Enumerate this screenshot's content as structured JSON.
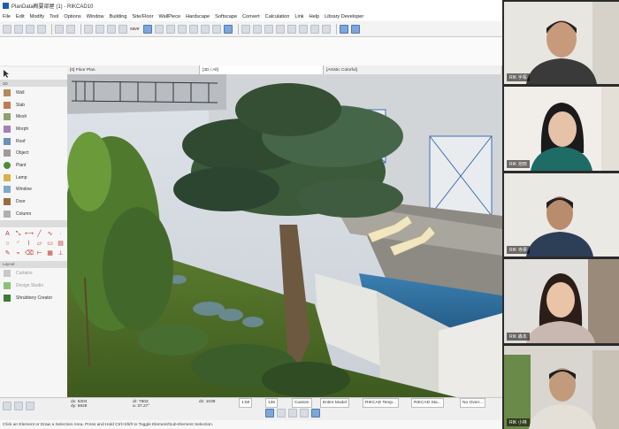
{
  "window": {
    "title": "PlanData概要部屋 (1) - RIKCAD10"
  },
  "menu": [
    "File",
    "Edit",
    "Modify",
    "Tool",
    "Options",
    "Window",
    "Building",
    "Site/Floor",
    "WallPiece",
    "Hardscape",
    "Softscape",
    "Convert",
    "Calculation",
    "Link",
    "Help",
    "Library Developer"
  ],
  "toolbar": {
    "save_label": "save"
  },
  "tabs": [
    "[0] Floor Plan",
    "[3D / All]",
    "[Artistic Colorful]"
  ],
  "toolbox": {
    "tools": [
      "Wall",
      "Slab",
      "Mesh",
      "Morph",
      "Roof",
      "Object",
      "Plant",
      "Lamp",
      "Window",
      "Door",
      "Column"
    ],
    "layout_section": "Layout",
    "layout_items": [
      "Curtains",
      "Design Studio",
      "Shrubbery Creator"
    ]
  },
  "status": {
    "coords": [
      "dx: 5304",
      "dy: 6828",
      "dr: 7503",
      "a: 37.27°",
      "dz: 1039"
    ],
    "scale": "1:50",
    "zoom": "136",
    "view": "Custom",
    "pen": "Entire Model",
    "layer1": "RIKCAD Temp...",
    "layer2": "RIKCAD Sta...",
    "no_overr": "No Overr...",
    "hint": "Click an Element or Draw a Selection Area. Press and Hold Ctrl+Shift to Toggle Element/Sub-Element Selection."
  },
  "participants": [
    {
      "name": "RIK 手塚"
    },
    {
      "name": "RIK 池田"
    },
    {
      "name": "RIK 寺澤"
    },
    {
      "name": "RIK 森本"
    },
    {
      "name": "RIK 小林"
    }
  ]
}
